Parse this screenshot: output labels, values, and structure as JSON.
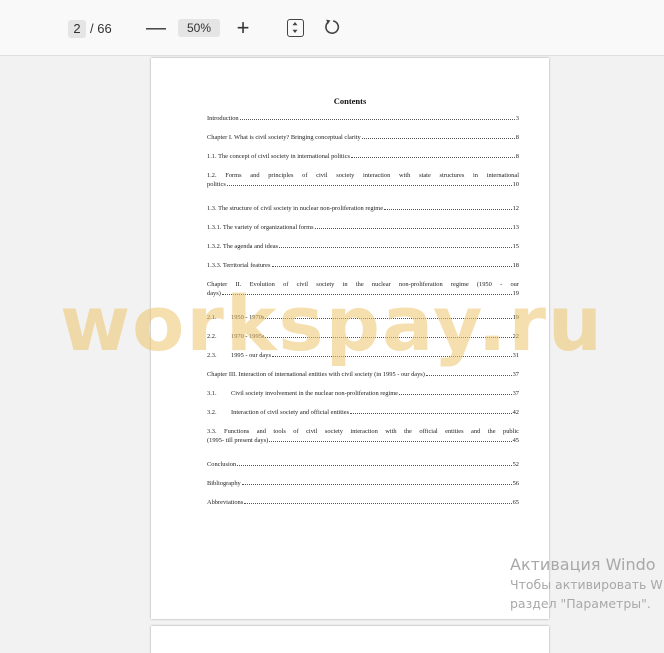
{
  "toolbar": {
    "current_page": "2",
    "total_pages": "/ 66",
    "zoom_level": "50%",
    "zoom_out_icon": "minus-icon",
    "zoom_in_icon": "plus-icon",
    "fit_icon": "fit-page-icon",
    "rotate_icon": "rotate-icon",
    "zoom_out_glyph": "—",
    "zoom_in_glyph": "+"
  },
  "document": {
    "title": "Contents",
    "entries": [
      {
        "title": "Introduction",
        "page": "3"
      },
      {
        "title": "Chapter I. What is civil society? Bringing conceptual clarity ",
        "page": "8"
      },
      {
        "title": "1.1. The concept of civil society in international politics ",
        "page": "8"
      },
      {
        "line1": "1.2.  Forms  and  principles  of  civil  society  interaction  with  state  structures  in  international",
        "title": "politics",
        "page": "10"
      },
      {
        "title": "1.3. The structure of civil society in nuclear non-proliferation regime",
        "page": "12"
      },
      {
        "title": "1.3.1. The variety of organizational forms",
        "page": "13"
      },
      {
        "title": "1.3.2. The agenda and ideas",
        "page": "15"
      },
      {
        "title": "1.3.3. Territorial features",
        "page": "18"
      },
      {
        "line1": "Chapter  II.  Evolution  of  civil  society  in  the  nuclear  non-proliferation  regime  (1950  -  our",
        "title": "days)",
        "page": "19"
      },
      {
        "num": "2.1.",
        "title": "1950 - 1970s",
        "page": "19"
      },
      {
        "num": "2.2.",
        "title": "1970 - 1995s",
        "page": "22"
      },
      {
        "num": "2.3.",
        "title": "1995 - our days ",
        "page": "31"
      },
      {
        "title": "Chapter III. Interaction of international entities with civil society (in 1995 - our days) ",
        "page": "37"
      },
      {
        "num": "3.1.",
        "title": "Civil society involvement in the nuclear non-proliferation regime ",
        "page": "37"
      },
      {
        "num": "3.2.",
        "title": "Interaction of civil society and official entities ",
        "page": "42"
      },
      {
        "line1": "3.3.       Functions  and  tools  of  civil  society  interaction  with  the  official  entities  and  the  public",
        "title": "(1995- till present days) ",
        "page": "45"
      },
      {
        "title": "Conclusion ",
        "page": "52"
      },
      {
        "title": "Bibliography ",
        "page": "56"
      },
      {
        "title": "Abbreviations",
        "page": "65"
      }
    ]
  },
  "watermark": {
    "text": "workspay.ru",
    "color": "#EDC46E"
  },
  "activation": {
    "line1": "Активация Windo",
    "line2": "Чтобы активировать W",
    "line3": "раздел \"Параметры\"."
  }
}
